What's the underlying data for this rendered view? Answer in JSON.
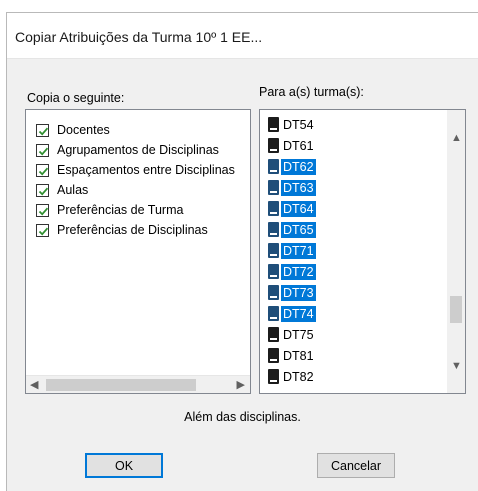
{
  "window": {
    "title": "Copiar Atribuições da Turma 10º 1 EE..."
  },
  "left": {
    "label": "Copia o seguinte:",
    "items": [
      {
        "label": "Docentes",
        "checked": true
      },
      {
        "label": "Agrupamentos de Disciplinas",
        "checked": true
      },
      {
        "label": "Espaçamentos entre Disciplinas",
        "checked": true
      },
      {
        "label": "Aulas",
        "checked": true
      },
      {
        "label": "Preferências de Turma",
        "checked": true
      },
      {
        "label": "Preferências de Disciplinas",
        "checked": true
      }
    ]
  },
  "right": {
    "label": "Para a(s) turma(s):",
    "items": [
      {
        "label": "DT54",
        "selected": false
      },
      {
        "label": "DT61",
        "selected": false
      },
      {
        "label": "DT62",
        "selected": true
      },
      {
        "label": "DT63",
        "selected": true
      },
      {
        "label": "DT64",
        "selected": true
      },
      {
        "label": "DT65",
        "selected": true
      },
      {
        "label": "DT71",
        "selected": true
      },
      {
        "label": "DT72",
        "selected": true
      },
      {
        "label": "DT73",
        "selected": true
      },
      {
        "label": "DT74",
        "selected": true
      },
      {
        "label": "DT75",
        "selected": false
      },
      {
        "label": "DT81",
        "selected": false
      },
      {
        "label": "DT82",
        "selected": false
      }
    ]
  },
  "note": "Além das disciplinas.",
  "buttons": {
    "ok": "OK",
    "cancel": "Cancelar"
  },
  "icons": {
    "scroll_left": "◀",
    "scroll_right": "▶",
    "scroll_up": "▲",
    "scroll_down": "▼"
  },
  "colors": {
    "selection": "#0078d7",
    "check": "#2f8f2f"
  }
}
